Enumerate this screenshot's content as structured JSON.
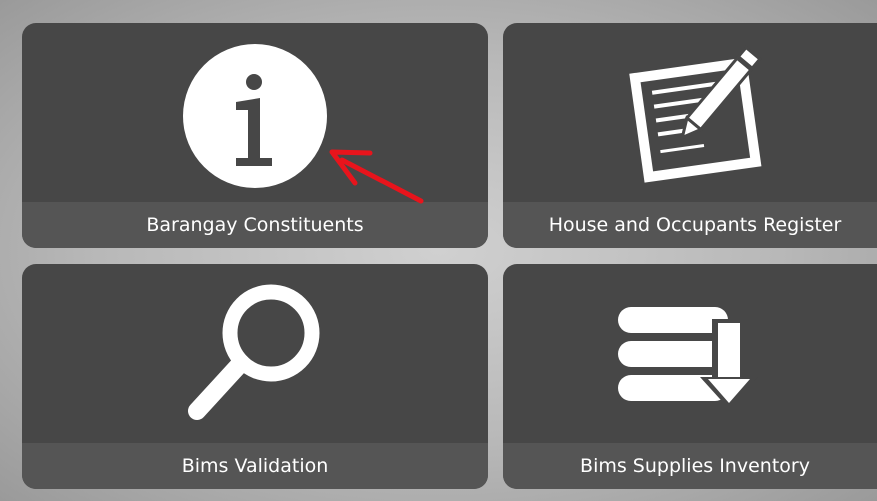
{
  "tiles": [
    {
      "label": "Barangay Constituents",
      "icon": "info-icon"
    },
    {
      "label": "House and Occupants Register",
      "icon": "register-pencil-icon"
    },
    {
      "label": "Bims Validation",
      "icon": "magnifier-icon"
    },
    {
      "label": "Bims Supplies Inventory",
      "icon": "inventory-download-icon"
    }
  ],
  "colors": {
    "tile_background": "#474747",
    "label_background": "#555555",
    "icon": "#ffffff",
    "annotation_arrow": "#e8141c"
  }
}
